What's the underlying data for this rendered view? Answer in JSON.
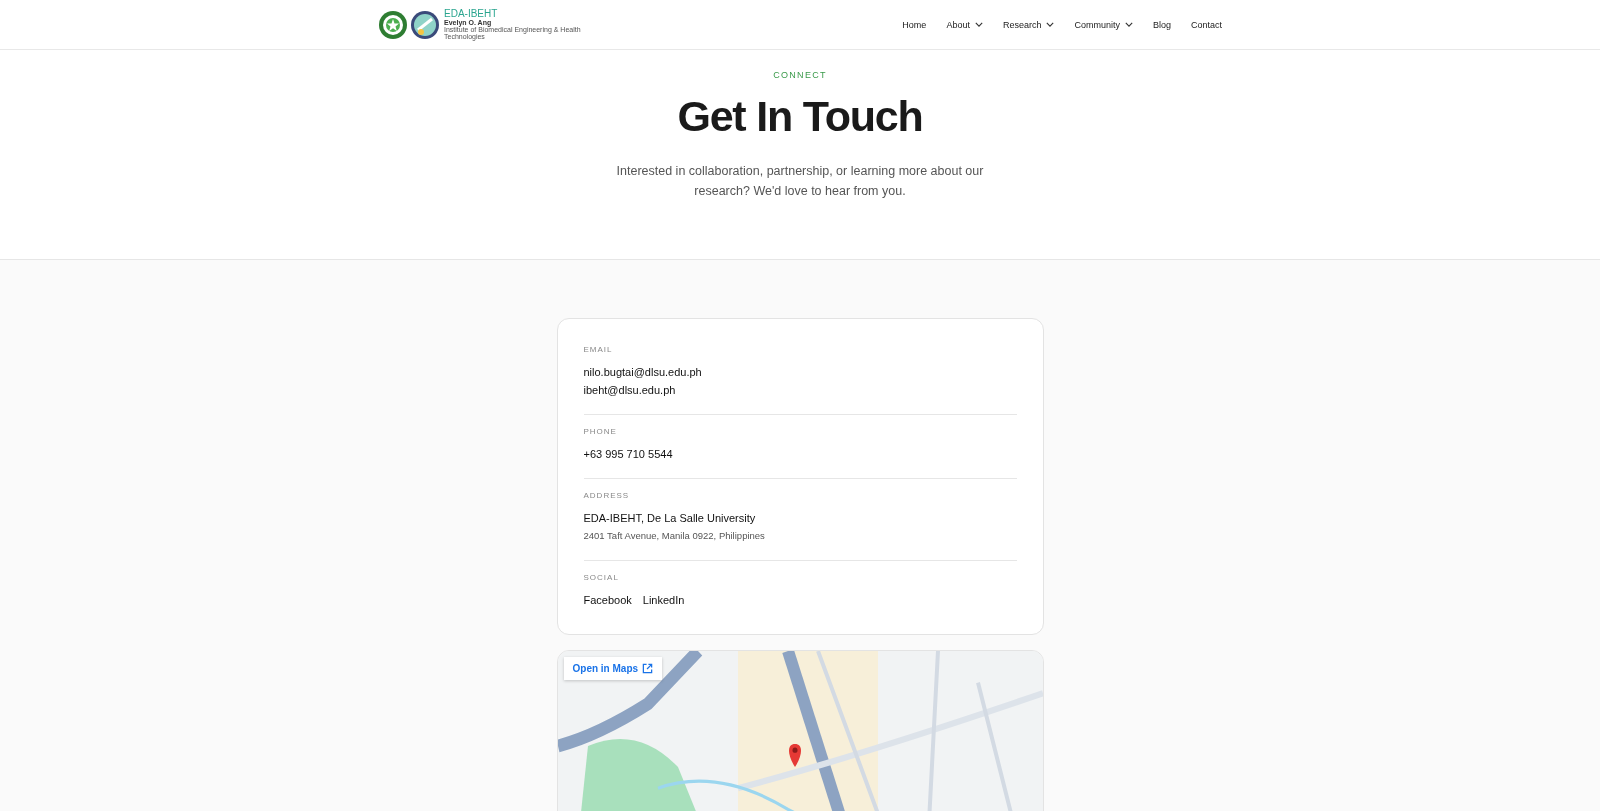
{
  "logo": {
    "title": "EDA-IBEHT",
    "subtitle": "Evelyn O. Ang",
    "caption": "Institute of Biomedical Engineering & Health Technologies"
  },
  "nav": [
    {
      "label": "Home",
      "dropdown": false
    },
    {
      "label": "About",
      "dropdown": true
    },
    {
      "label": "Research",
      "dropdown": true
    },
    {
      "label": "Community",
      "dropdown": true
    },
    {
      "label": "Blog",
      "dropdown": false
    },
    {
      "label": "Contact",
      "dropdown": false
    }
  ],
  "hero": {
    "eyebrow": "CONNECT",
    "title": "Get In Touch",
    "text": "Interested in collaboration, partnership, or learning more about our research? We'd love to hear from you."
  },
  "contact": [
    {
      "kind": "lines",
      "label": "EMAIL",
      "lines": [
        "nilo.bugtai@dlsu.edu.ph",
        "ibeht@dlsu.edu.ph"
      ]
    },
    {
      "kind": "lines",
      "label": "PHONE",
      "lines": [
        "+63 995 710 5544"
      ]
    },
    {
      "kind": "address",
      "label": "ADDRESS",
      "lines": [
        "EDA-IBEHT, De La Salle University",
        "2401 Taft Avenue, Manila 0922, Philippines"
      ]
    },
    {
      "kind": "links",
      "label": "SOCIAL",
      "lines": [
        "Facebook",
        "LinkedIn"
      ]
    }
  ],
  "map": {
    "button": "Open in Maps"
  }
}
